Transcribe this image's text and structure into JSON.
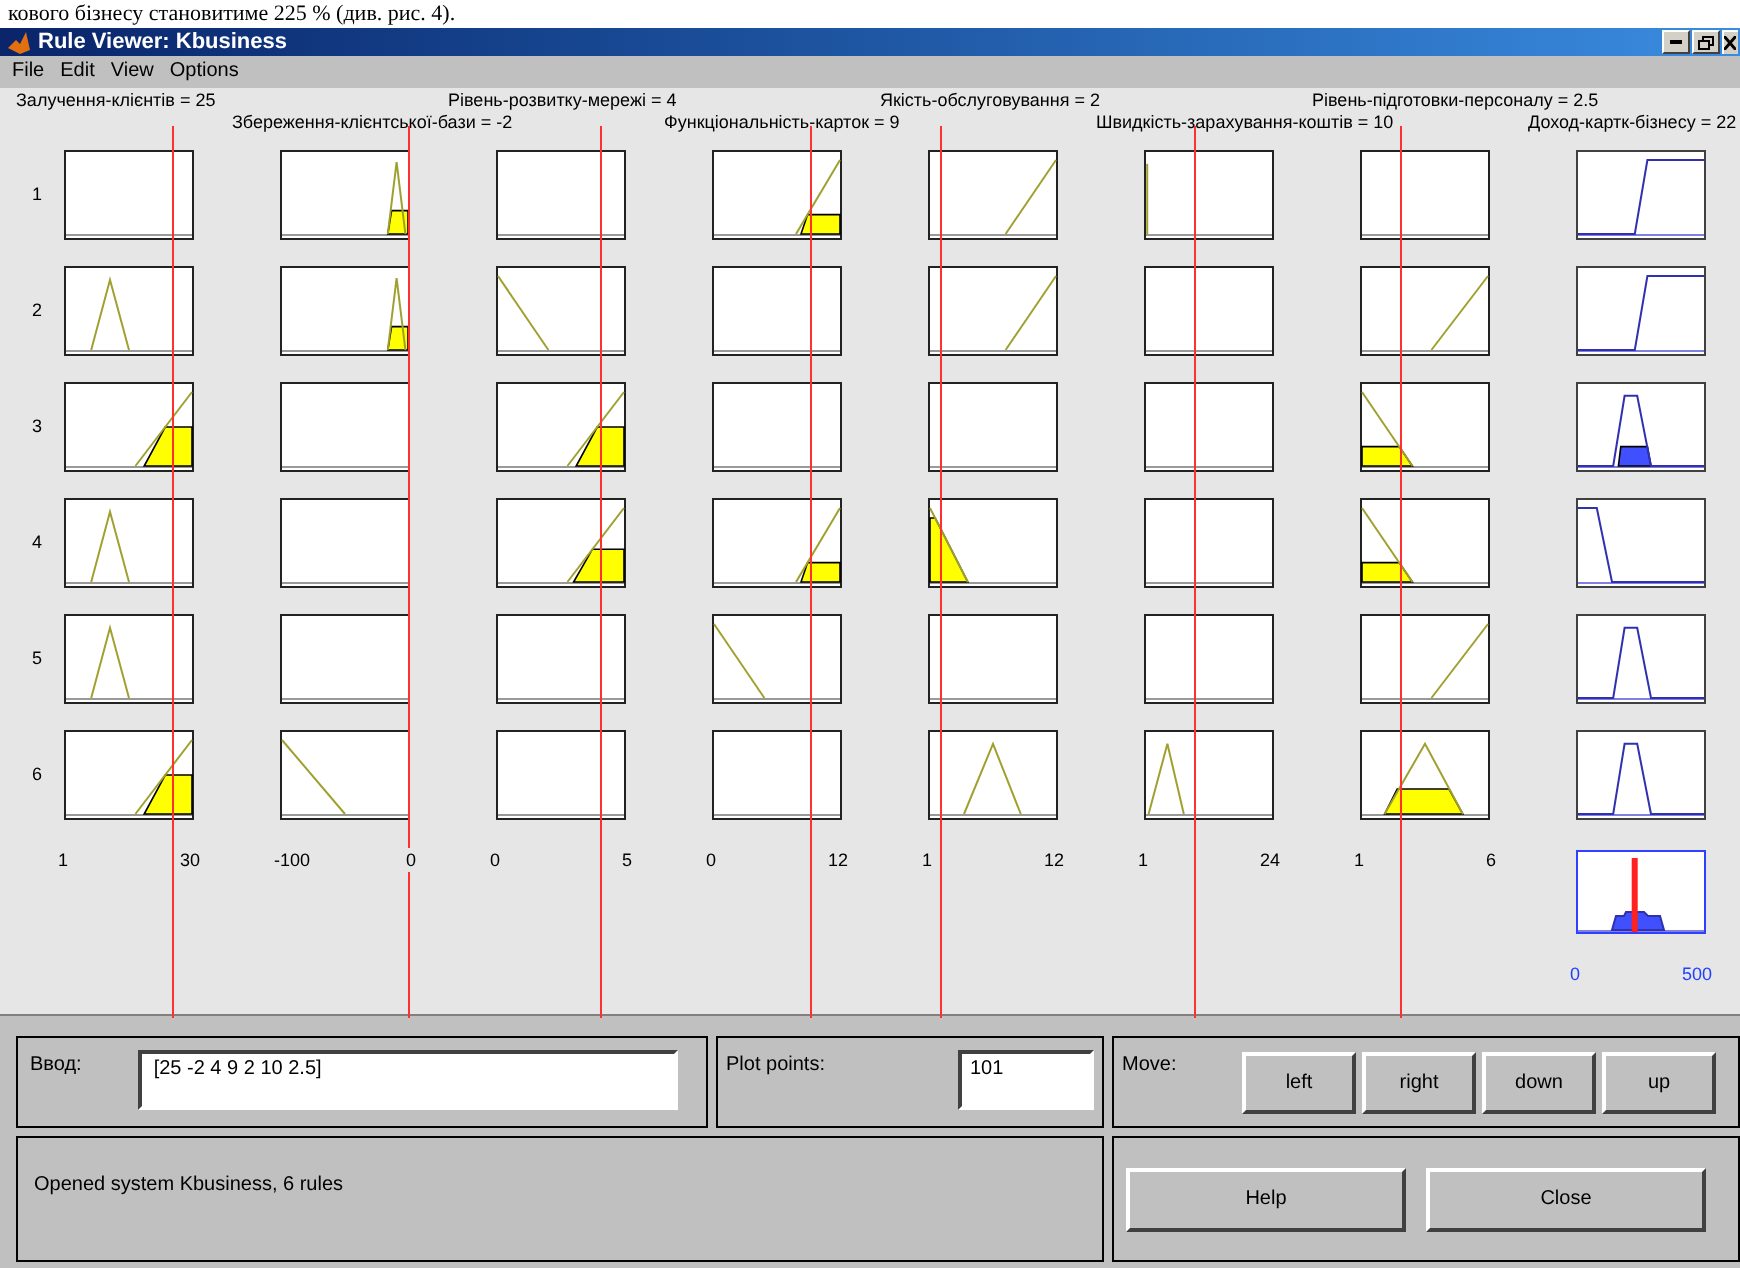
{
  "document_text": "кового бізнесу становитиме 225 % (див. рис. 4).",
  "window": {
    "title": "Rule Viewer: Kbusiness"
  },
  "menu": [
    "File",
    "Edit",
    "View",
    "Options"
  ],
  "inputs": [
    {
      "label": "Залучення-клієнтів = 25",
      "ticks": [
        "1",
        "30"
      ]
    },
    {
      "label": "Збереження-клієнтської-бази = -2",
      "ticks": [
        "-100",
        "0"
      ]
    },
    {
      "label": "Рівень-розвитку-мережі = 4",
      "ticks": [
        "0",
        "5"
      ]
    },
    {
      "label": "Функціональність-карток = 9",
      "ticks": [
        "0",
        "12"
      ]
    },
    {
      "label": "Якість-обслуговування = 2",
      "ticks": [
        "1",
        "12"
      ]
    },
    {
      "label": "Швидкість-зарахування-коштів = 10",
      "ticks": [
        "1",
        "24"
      ]
    },
    {
      "label": "Рівень-підготовки-персоналу = 2.5",
      "ticks": [
        "1",
        "6"
      ]
    }
  ],
  "output": {
    "label": "Доход-картк-бізнесу = 22",
    "ticks": [
      "0",
      "500"
    ]
  },
  "rules": [
    "1",
    "2",
    "3",
    "4",
    "5",
    "6"
  ],
  "input_field": {
    "label": "Ввод:",
    "value": "[25 -2 4 9 2 10 2.5]"
  },
  "plot_points": {
    "label": "Plot points:",
    "value": "101"
  },
  "move": {
    "label": "Move:",
    "buttons": [
      "left",
      "right",
      "down",
      "up"
    ]
  },
  "status": "Opened system Kbusiness, 6 rules",
  "buttons": [
    "Help",
    "Close"
  ]
}
